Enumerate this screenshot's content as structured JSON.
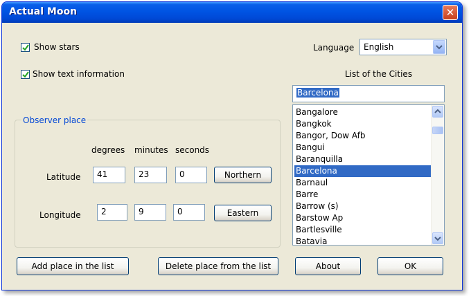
{
  "window": {
    "title": "Actual Moon"
  },
  "options": {
    "show_stars": {
      "label": "Show stars",
      "checked": true
    },
    "show_text": {
      "label": "Show text information",
      "checked": true
    }
  },
  "language": {
    "label": "Language",
    "value": "English"
  },
  "cities": {
    "header": "List of the Cities",
    "search_value": "Barcelona",
    "items": [
      "Bangalore",
      "Bangkok",
      "Bangor, Dow Afb",
      "Bangui",
      "Baranquilla",
      "Barcelona",
      "Barnaul",
      "Barre",
      "Barrow (s)",
      "Barstow Ap",
      "Bartlesville",
      "Batavia"
    ],
    "selected": "Barcelona"
  },
  "observer": {
    "legend": "Observer place",
    "headers": {
      "degrees": "degrees",
      "minutes": "minutes",
      "seconds": "seconds"
    },
    "latitude": {
      "label": "Latitude",
      "degrees": "41",
      "minutes": "23",
      "seconds": "0",
      "hemisphere": "Northern"
    },
    "longitude": {
      "label": "Longitude",
      "degrees": "2",
      "minutes": "9",
      "seconds": "0",
      "hemisphere": "Eastern"
    }
  },
  "buttons": {
    "add": "Add place in the list",
    "delete": "Delete place from the list",
    "about": "About",
    "ok": "OK"
  },
  "icons": {
    "close": "close-icon",
    "check": "check-icon",
    "dropdown": "chevron-down-icon",
    "up": "chevron-up-icon",
    "down": "chevron-down-icon"
  }
}
